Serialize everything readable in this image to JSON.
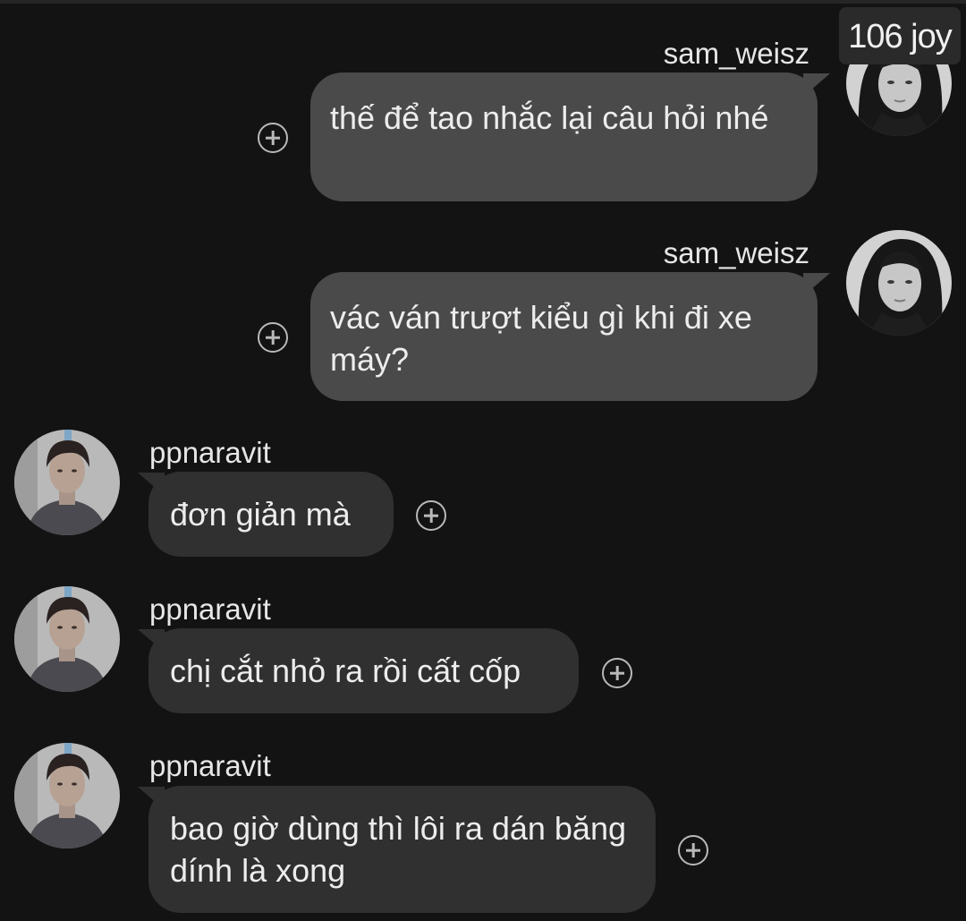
{
  "header": {
    "count_badge": "106 joy"
  },
  "messages": [
    {
      "sender": "sam_weisz",
      "direction": "outgoing",
      "text": "thế để tao nhắc lại câu hỏi nhé"
    },
    {
      "sender": "sam_weisz",
      "direction": "outgoing",
      "text": "vác ván trượt kiểu gì khi đi xe máy?"
    },
    {
      "sender": "ppnaravit",
      "direction": "incoming",
      "text": "đơn giản mà"
    },
    {
      "sender": "ppnaravit",
      "direction": "incoming",
      "text": "chị cắt nhỏ ra rồi cất cốp"
    },
    {
      "sender": "ppnaravit",
      "direction": "incoming",
      "text": "bao giờ dùng thì lôi ra dán băng dính là xong"
    }
  ],
  "icons": {
    "react": "add-reaction-icon"
  },
  "colors": {
    "background": "#131313",
    "outgoing_bubble": "#4a4a4a",
    "incoming_bubble": "#303030",
    "text": "#ededed"
  }
}
